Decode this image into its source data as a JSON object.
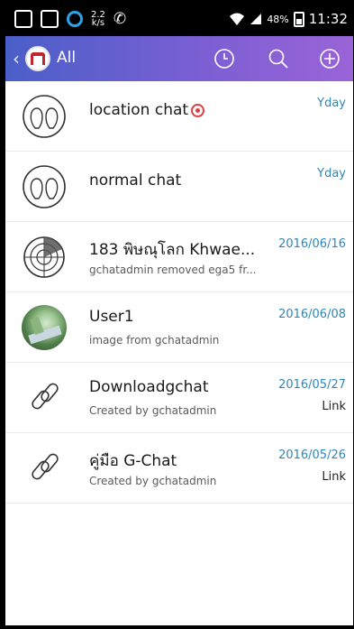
{
  "status_bar": {
    "speed": "2.2\nk/s",
    "battery_percent": "48%",
    "time": "11:32"
  },
  "header": {
    "title": "All",
    "back_icon": "chevron-left-icon",
    "logo_icon": "building-logo-icon",
    "history_icon": "clock-icon",
    "search_icon": "search-icon",
    "add_icon": "plus-circle-icon"
  },
  "chats": [
    {
      "name": "location chat",
      "subtitle": "",
      "date": "Yday",
      "tag": "",
      "icon": "chat-group-icon",
      "has_location_pin": true
    },
    {
      "name": "normal chat",
      "subtitle": "",
      "date": "Yday",
      "tag": "",
      "icon": "chat-group-icon",
      "has_location_pin": false
    },
    {
      "name": "183 พิษณุโลก Khwae...",
      "subtitle": "gchatadmin removed ega5 fr...",
      "date": "2016/06/16",
      "tag": "",
      "icon": "radar-icon"
    },
    {
      "name": "User1",
      "subtitle": "image from gchatadmin",
      "date": "2016/06/08",
      "tag": "",
      "icon": "user-photo-avatar"
    },
    {
      "name": "Downloadgchat",
      "subtitle": "Created by gchatadmin",
      "date": "2016/05/27",
      "tag": "Link",
      "icon": "link-icon"
    },
    {
      "name": "คู่มือ G-Chat",
      "subtitle": "Created by gchatadmin",
      "date": "2016/05/26",
      "tag": "Link",
      "icon": "link-icon"
    }
  ],
  "colors": {
    "header_start": "#4a5fc9",
    "header_end": "#9b63d8",
    "date_text": "#2f86b8",
    "location_pin": "#e33b3b"
  }
}
